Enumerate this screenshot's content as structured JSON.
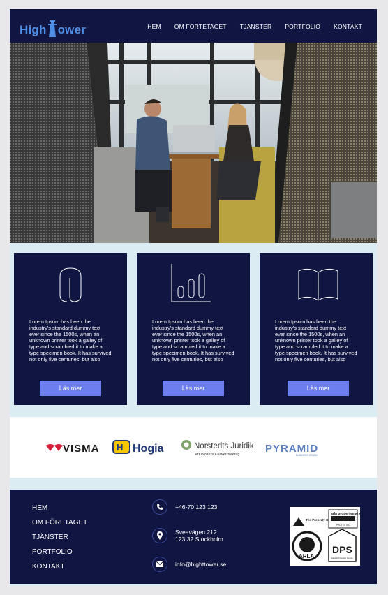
{
  "header": {
    "logo_part1": "High",
    "logo_part2": "ower",
    "nav": [
      "HEM",
      "OM FÖRTETAGET",
      "TJÄNSTER",
      "PORTFOLIO",
      "KONTAKT"
    ]
  },
  "cards": [
    {
      "icon": "paperclip-icon",
      "text": "Lorem Ipsum has been the industry's standard dummy text ever since the 1500s, when an unknown printer took a galley of type and scrambled it to make a type specimen book. It has survived not only five centuries, but also",
      "button": "Läs mer"
    },
    {
      "icon": "bar-chart-icon",
      "text": "Lorem Ipsum has been the industry's standard dummy text ever since the 1500s, when an unknown printer took a galley of type and scrambled it to make a type specimen book. It has survived not only five centuries, but also",
      "button": "Läs mer"
    },
    {
      "icon": "open-book-icon",
      "text": "Lorem Ipsum has been the industry's standard dummy text ever since the 1500s, when an unknown printer took a galley of type and scrambled it to make a type specimen book. It has survived not only five centuries, but also",
      "button": "Läs mer"
    }
  ],
  "partners": {
    "visma": "VISMA",
    "hogia": "Hogia",
    "norstedts_title": "Norstedts Juridik",
    "norstedts_sub": "ett Wolters Kluwer-företag",
    "pyramid": "PYRAMID",
    "pyramid_sub": "BUSINESS STUDIO"
  },
  "footer": {
    "links": [
      "HEM",
      "OM FÖRETAGET",
      "TJÄNSTER",
      "PORTFOLIO",
      "KONTAKT"
    ],
    "phone": "+46-70 123 123",
    "address_line1": "Sveavägen 212",
    "address_line2": "123 32 Stockholm",
    "email": "info@highttower.se",
    "badges": {
      "property_ombudsman": "The Property Ombudsman",
      "arla_pm": "arla propertymark",
      "arla_pm_sub": "PROTECTED",
      "arla": "ARLA",
      "dps": "DPS",
      "dps_sub": "Deposit Protection Service"
    }
  },
  "colors": {
    "navy": "#101641",
    "accent": "#6d7ff0",
    "logo_blue": "#4f8fe6",
    "page_bg": "#dcecf3"
  }
}
